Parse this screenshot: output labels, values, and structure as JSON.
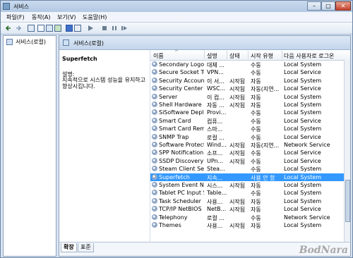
{
  "window": {
    "title": "서비스"
  },
  "menu": [
    "파일(F)",
    "동작(A)",
    "보기(V)",
    "도움말(H)"
  ],
  "left_pane": {
    "node_label": "서비스(로컬)"
  },
  "right_pane": {
    "header": "서비스(로컬)",
    "description": {
      "service_name": "Superfetch",
      "label": "설명:",
      "text": "지속적으로 시스템 성능을 유지하고 향상시킵니다."
    },
    "columns": [
      "이름",
      "설명",
      "상태",
      "시작 유형",
      "다음 사용자로 로그온"
    ],
    "services": [
      {
        "name": "Secondary Logon",
        "desc": "대체 ...",
        "status": "",
        "startup": "수동",
        "logon": "Local System"
      },
      {
        "name": "Secure Socket Tu...",
        "desc": "VPN...",
        "status": "",
        "startup": "수동",
        "logon": "Local Service"
      },
      {
        "name": "Security Accounts...",
        "desc": "이 서...",
        "status": "시작됨",
        "startup": "자동",
        "logon": "Local System"
      },
      {
        "name": "Security Center",
        "desc": "WSC...",
        "status": "시작됨",
        "startup": "자동(지연...",
        "logon": "Local Service"
      },
      {
        "name": "Server",
        "desc": "이 컴...",
        "status": "시작됨",
        "startup": "자동",
        "logon": "Local System"
      },
      {
        "name": "Shell Hardware D...",
        "desc": "자동 ...",
        "status": "시작됨",
        "startup": "자동",
        "logon": "Local System"
      },
      {
        "name": "SiSoftware Deplo...",
        "desc": "Provi...",
        "status": "",
        "startup": "수동",
        "logon": "Local System"
      },
      {
        "name": "Smart Card",
        "desc": "컴퓨...",
        "status": "",
        "startup": "수동",
        "logon": "Local Service"
      },
      {
        "name": "Smart Card Remo...",
        "desc": "스마...",
        "status": "",
        "startup": "수동",
        "logon": "Local System"
      },
      {
        "name": "SNMP Trap",
        "desc": "로컬 ...",
        "status": "",
        "startup": "수동",
        "logon": "Local Service"
      },
      {
        "name": "Software Protection",
        "desc": "Wind...",
        "status": "시작됨",
        "startup": "자동(지연...",
        "logon": "Network Service"
      },
      {
        "name": "SPP Notification ...",
        "desc": "소프...",
        "status": "시작됨",
        "startup": "수동",
        "logon": "Local Service"
      },
      {
        "name": "SSDP Discovery",
        "desc": "UPn...",
        "status": "시작됨",
        "startup": "수동",
        "logon": "Local Service"
      },
      {
        "name": "Steam Client Serv...",
        "desc": "Stea...",
        "status": "",
        "startup": "수동",
        "logon": "Local System"
      },
      {
        "name": "Superfetch",
        "desc": "지속...",
        "status": "",
        "startup": "사용 안 함",
        "logon": "Local System"
      },
      {
        "name": "System Event Not...",
        "desc": "시스...",
        "status": "시작됨",
        "startup": "자동",
        "logon": "Local System"
      },
      {
        "name": "Tablet PC Input S...",
        "desc": "Table...",
        "status": "",
        "startup": "수동",
        "logon": "Local System"
      },
      {
        "name": "Task Scheduler",
        "desc": "사용...",
        "status": "시작됨",
        "startup": "자동",
        "logon": "Local System"
      },
      {
        "name": "TCP/IP NetBIOS ...",
        "desc": "NetB...",
        "status": "시작됨",
        "startup": "자동",
        "logon": "Local Service"
      },
      {
        "name": "Telephony",
        "desc": "로컬 ...",
        "status": "",
        "startup": "수동",
        "logon": "Network Service"
      },
      {
        "name": "Themes",
        "desc": "사용...",
        "status": "시작됨",
        "startup": "자동",
        "logon": "Local System"
      }
    ],
    "selected_service": "Superfetch",
    "tabs": [
      "확장",
      "표준"
    ]
  },
  "watermark": "BodNara"
}
